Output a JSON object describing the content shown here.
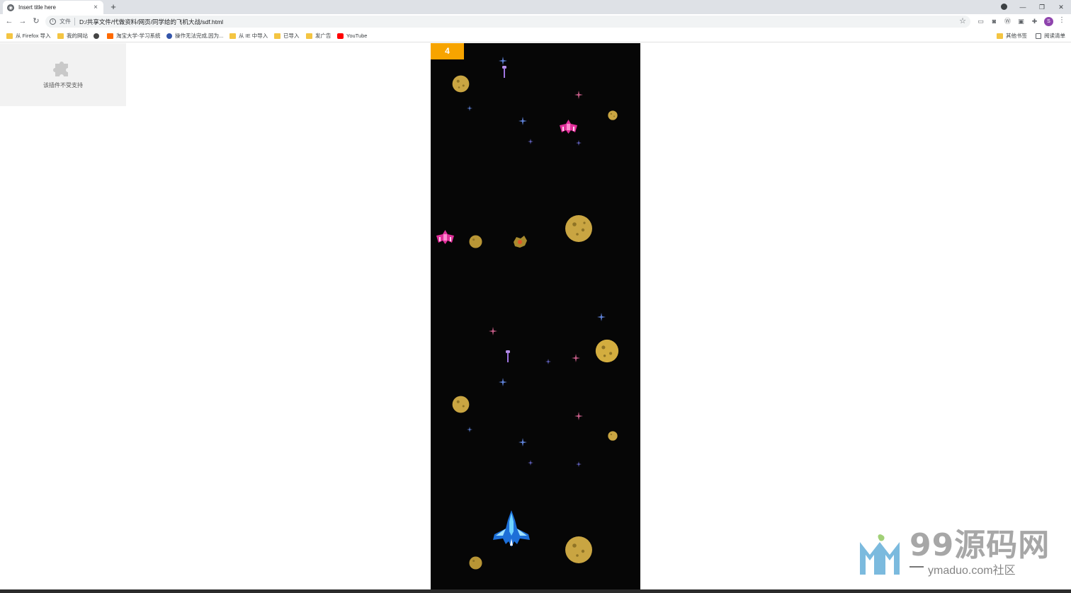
{
  "browser": {
    "tab_title": "Insert title here",
    "tab_close": "×",
    "new_tab": "+",
    "address_chip": "文件",
    "url": "D:/共享文件/代做资料/网页/同学给的飞机大战/sdf.html",
    "avatar_letter": "S"
  },
  "bookmarks": [
    {
      "label": "从 Firefox 导入",
      "icon": "folder-icon"
    },
    {
      "label": "我的网站",
      "icon": "folder-icon"
    },
    {
      "label": "",
      "icon": "globe-icon"
    },
    {
      "label": "淘宝大学-学习系统",
      "icon": "site-icon"
    },
    {
      "label": "操作无法完成,因为...",
      "icon": "site-icon"
    },
    {
      "label": "从 IE 中导入",
      "icon": "folder-icon"
    },
    {
      "label": "已导入",
      "icon": "folder-icon"
    },
    {
      "label": "发广告",
      "icon": "folder-icon"
    },
    {
      "label": "YouTube",
      "icon": "youtube-icon"
    }
  ],
  "bookmarks_right": [
    {
      "label": "其他书签",
      "icon": "folder-icon"
    },
    {
      "label": "阅读清单",
      "icon": "reading-list-icon"
    }
  ],
  "plugin": {
    "message": "该插件不受支持",
    "icon": "puzzle-icon"
  },
  "game": {
    "score": "4",
    "player": "player-jet",
    "enemies": [
      "enemy-ship",
      "enemy-ship"
    ],
    "colors": {
      "score_bg": "#f7a400",
      "space": "#060606",
      "asteroid": "#c9a542",
      "enemy": "#e0309a",
      "bullet": "#b58ee8"
    }
  },
  "watermark": {
    "brand": "99源码网",
    "sub": "ymaduo.com社区"
  }
}
